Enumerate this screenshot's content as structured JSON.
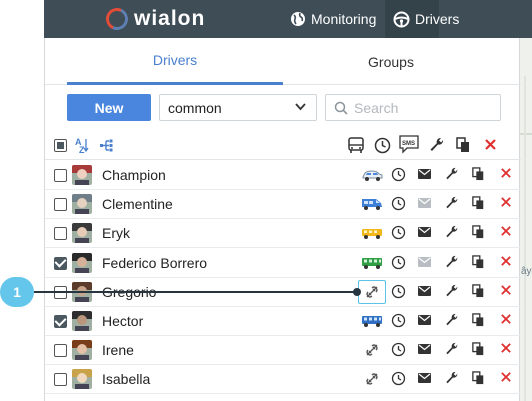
{
  "topbar": {
    "logo_text": "wialon",
    "nav": [
      {
        "label": "Monitoring",
        "icon": "globe-icon"
      },
      {
        "label": "Drivers",
        "icon": "steering-wheel-icon",
        "active": true
      }
    ]
  },
  "tabs": [
    {
      "label": "Drivers",
      "active": true
    },
    {
      "label": "Groups",
      "active": false
    }
  ],
  "toolbar": {
    "new_label": "New",
    "resource_value": "common",
    "search_placeholder": "Search"
  },
  "header_icons": [
    "sort-az-icon",
    "group-tree-icon",
    "bus-icon",
    "clock-icon",
    "sms-icon",
    "wrench-icon",
    "copy-icon",
    "delete-icon"
  ],
  "drivers": [
    {
      "name": "Champion",
      "checked": false,
      "vehicle": "car-icon"
    },
    {
      "name": "Clementine",
      "checked": false,
      "vehicle": "van-icon"
    },
    {
      "name": "Eryk",
      "checked": false,
      "vehicle": "yellow-truck-icon"
    },
    {
      "name": "Federico Borrero",
      "checked": true,
      "vehicle": "green-bus-icon"
    },
    {
      "name": "Gregorio",
      "checked": false,
      "vehicle": "unassigned-icon"
    },
    {
      "name": "Hector",
      "checked": true,
      "vehicle": "blue-bus-icon"
    },
    {
      "name": "Irene",
      "checked": false,
      "vehicle": "unassigned-icon"
    },
    {
      "name": "Isabella",
      "checked": false,
      "vehicle": "unassigned-icon"
    }
  ],
  "callout": {
    "label": "1"
  },
  "map": {
    "label_a": "ây"
  },
  "colors": {
    "accent": "#4a80ce",
    "topbar": "#3e4d56",
    "delete": "#e02f2f",
    "callout": "#64c6ea"
  }
}
